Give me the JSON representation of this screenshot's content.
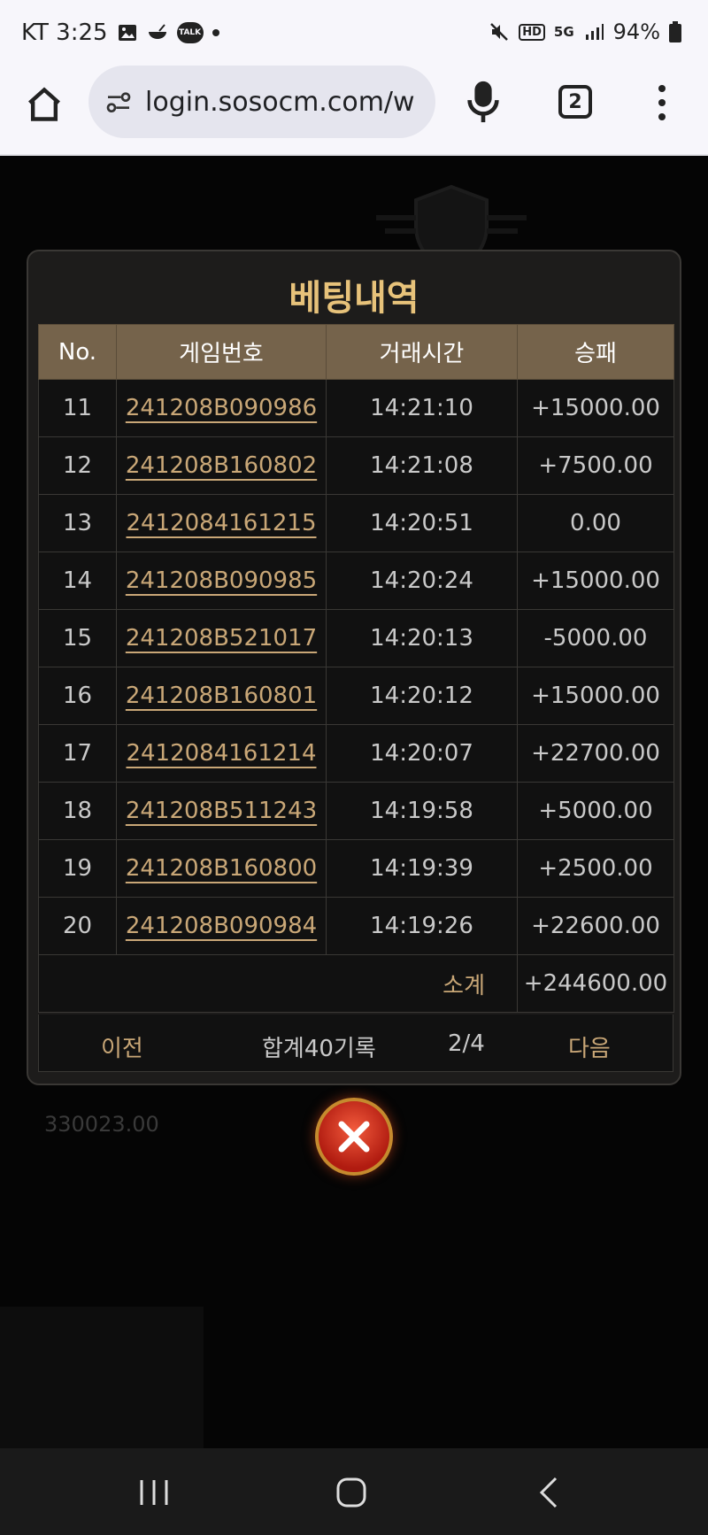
{
  "status_bar": {
    "carrier_time": "KT 3:25",
    "talk_badge": "TALK",
    "network": "5G",
    "hd": "HD",
    "battery": "94%"
  },
  "browser": {
    "url": "login.sosocm.com/w",
    "tab_count": "2"
  },
  "background": {
    "balance": "330023.00"
  },
  "modal": {
    "title": "베팅내역",
    "columns": [
      "No.",
      "게임번호",
      "거래시간",
      "승패"
    ],
    "rows": [
      {
        "no": "11",
        "game": "241208B090986",
        "time": "14:21:10",
        "result": "+15000.00",
        "status": "pos"
      },
      {
        "no": "12",
        "game": "241208B160802",
        "time": "14:21:08",
        "result": "+7500.00",
        "status": "pos"
      },
      {
        "no": "13",
        "game": "2412084161215",
        "time": "14:20:51",
        "result": "0.00",
        "status": "zero"
      },
      {
        "no": "14",
        "game": "241208B090985",
        "time": "14:20:24",
        "result": "+15000.00",
        "status": "pos"
      },
      {
        "no": "15",
        "game": "241208B521017",
        "time": "14:20:13",
        "result": "-5000.00",
        "status": "neg"
      },
      {
        "no": "16",
        "game": "241208B160801",
        "time": "14:20:12",
        "result": "+15000.00",
        "status": "pos"
      },
      {
        "no": "17",
        "game": "2412084161214",
        "time": "14:20:07",
        "result": "+22700.00",
        "status": "pos"
      },
      {
        "no": "18",
        "game": "241208B511243",
        "time": "14:19:58",
        "result": "+5000.00",
        "status": "pos"
      },
      {
        "no": "19",
        "game": "241208B160800",
        "time": "14:19:39",
        "result": "+2500.00",
        "status": "pos"
      },
      {
        "no": "20",
        "game": "241208B090984",
        "time": "14:19:26",
        "result": "+22600.00",
        "status": "pos"
      }
    ],
    "subtotal_label": "소계",
    "subtotal_value": "+244600.00",
    "pager": {
      "prev": "이전",
      "total": "합계40기록",
      "page": "2/4",
      "next": "다음"
    }
  },
  "colors": {
    "accent_gold": "#e7c27a",
    "header_bg": "#75634b",
    "positive": "#2cc12c",
    "negative": "#e53a32"
  }
}
